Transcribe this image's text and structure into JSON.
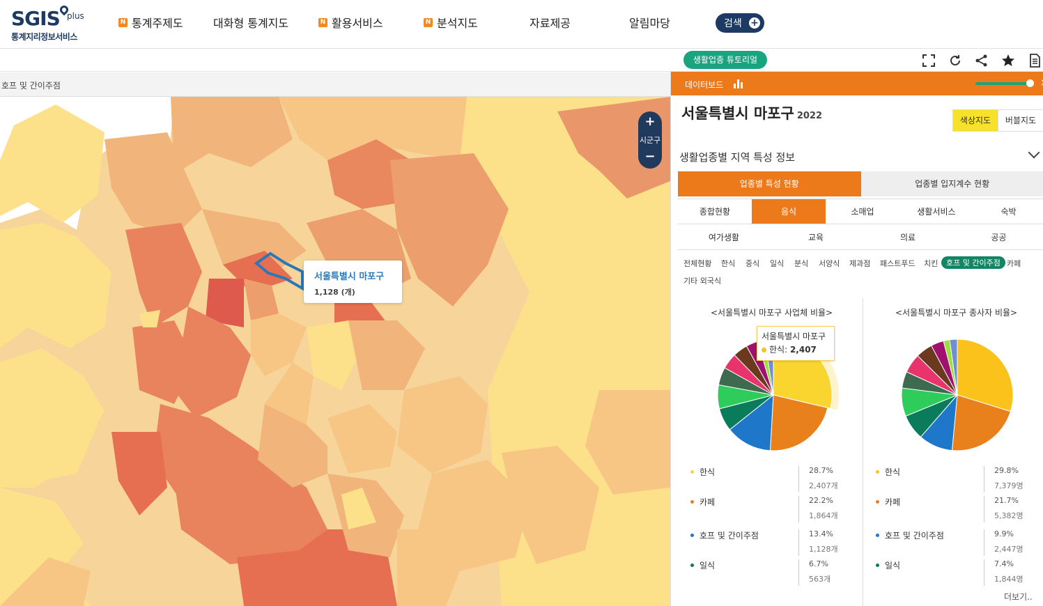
{
  "header": {
    "logo_main": "SGIS",
    "logo_plus": "plus",
    "logo_sub": "통계지리정보서비스",
    "nav": [
      {
        "label": "통계주제도",
        "badge": "N"
      },
      {
        "label": "대화형 통계지도",
        "badge": ""
      },
      {
        "label": "활용서비스",
        "badge": "N"
      },
      {
        "label": "분석지도",
        "badge": "N"
      },
      {
        "label": "자료제공",
        "badge": ""
      },
      {
        "label": "알림마당",
        "badge": ""
      }
    ],
    "search_label": "검색"
  },
  "toolbar": {
    "tutorial_label": "생활업종 튜토리얼",
    "icons": [
      "fullscreen-icon",
      "refresh-icon",
      "share-icon",
      "star-icon",
      "document-icon"
    ]
  },
  "map": {
    "title": "호프 및 간이주점",
    "zoom_label": "시군구",
    "zoom_in": "+",
    "zoom_out": "−",
    "tooltip": {
      "title": "서울특별시 마포구",
      "value": "1,128 (개)"
    }
  },
  "dashboard": {
    "label": "데이터보드",
    "region": "서울특별시 마포구",
    "year": "2022",
    "map_types": [
      "색상지도",
      "버블지도"
    ],
    "section_title": "생활업종별 지역 특성 정보",
    "main_tabs": [
      "업종별 특성 현황",
      "업종별 입지계수 현황"
    ],
    "category_tabs_row1": [
      "종합현황",
      "음식",
      "소매업",
      "생활서비스",
      "숙박"
    ],
    "category_tabs_row2": [
      "여가생활",
      "교육",
      "의료",
      "공공"
    ],
    "chips": [
      "전체현황",
      "한식",
      "중식",
      "일식",
      "분식",
      "서양식",
      "제과점",
      "패스트푸드",
      "치킨",
      "호프 및 간이주점",
      "카페",
      "기타 외국식"
    ],
    "more_label": "더보기..",
    "colors": {
      "accent": "#ec7a1b",
      "green": "#1aa37f",
      "navy": "#1f3a5c"
    }
  },
  "chart_data": [
    {
      "type": "pie",
      "title": "<서울특별시 마포구 사업체 비율>",
      "tooltip": {
        "title": "서울특별시 마포구",
        "label": "한식",
        "value": "2,407"
      },
      "slices": [
        {
          "name": "한식",
          "pct": 28.7,
          "count": "2,407개",
          "color": "#fbd52f"
        },
        {
          "name": "카페",
          "pct": 22.2,
          "count": "1,864개",
          "color": "#e8801c"
        },
        {
          "name": "호프 및 간이주점",
          "pct": 13.4,
          "count": "1,128개",
          "color": "#1f77c9"
        },
        {
          "name": "일식",
          "pct": 6.7,
          "count": "563개",
          "color": "#0a7c5c"
        },
        {
          "name": "",
          "pct": 6.9,
          "count": "",
          "color": "#2ecc5a"
        },
        {
          "name": "",
          "pct": 5.2,
          "count": "",
          "color": "#3e6b4f"
        },
        {
          "name": "",
          "pct": 4.6,
          "count": "",
          "color": "#e8336d"
        },
        {
          "name": "",
          "pct": 4.3,
          "count": "",
          "color": "#6b3a1e"
        },
        {
          "name": "",
          "pct": 3.5,
          "count": "",
          "color": "#a0106e"
        },
        {
          "name": "",
          "pct": 2.0,
          "count": "",
          "color": "#9be13a"
        },
        {
          "name": "",
          "pct": 2.5,
          "count": "",
          "color": "#6f8fd0"
        }
      ]
    },
    {
      "type": "pie",
      "title": "<서울특별시 마포구 종사자 비율>",
      "slices": [
        {
          "name": "한식",
          "pct": 29.8,
          "count": "7,379명",
          "color": "#fbc21c"
        },
        {
          "name": "카페",
          "pct": 21.7,
          "count": "5,382명",
          "color": "#e8801c"
        },
        {
          "name": "호프 및 간이주점",
          "pct": 9.9,
          "count": "2,447명",
          "color": "#1f77c9"
        },
        {
          "name": "일식",
          "pct": 7.4,
          "count": "1,844명",
          "color": "#0a7c5c"
        },
        {
          "name": "",
          "pct": 8.2,
          "count": "",
          "color": "#2ecc5a"
        },
        {
          "name": "",
          "pct": 4.8,
          "count": "",
          "color": "#3e6b4f"
        },
        {
          "name": "",
          "pct": 5.6,
          "count": "",
          "color": "#e8336d"
        },
        {
          "name": "",
          "pct": 4.9,
          "count": "",
          "color": "#6b3a1e"
        },
        {
          "name": "",
          "pct": 3.7,
          "count": "",
          "color": "#a0106e"
        },
        {
          "name": "",
          "pct": 1.8,
          "count": "",
          "color": "#9be13a"
        },
        {
          "name": "",
          "pct": 2.2,
          "count": "",
          "color": "#6f8fd0"
        }
      ]
    }
  ]
}
